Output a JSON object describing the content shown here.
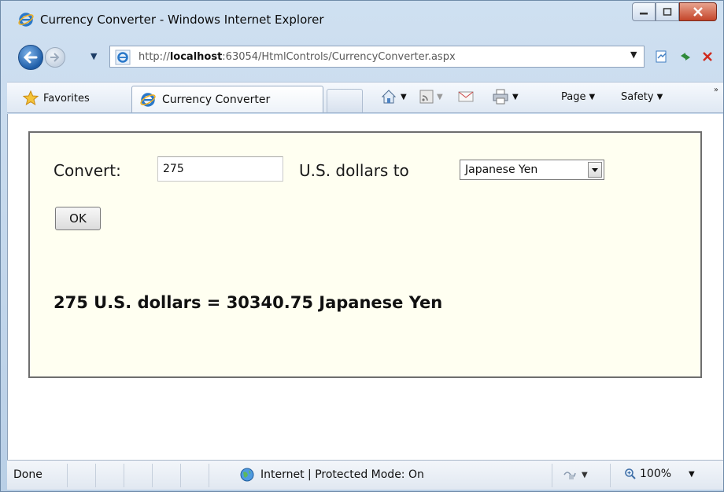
{
  "window": {
    "title": "Currency Converter - Windows Internet Explorer"
  },
  "address_bar": {
    "url_prefix": "http://",
    "url_host": "localhost",
    "url_rest": ":63054/HtmlControls/CurrencyConverter.aspx"
  },
  "command_bar": {
    "favorites_label": "Favorites",
    "tab_title": "Currency Converter",
    "page_label": "Page",
    "safety_label": "Safety"
  },
  "form": {
    "convert_label": "Convert:",
    "amount_value": "275",
    "usd_label": "U.S. dollars to",
    "currency_selected": "Japanese Yen",
    "ok_label": "OK",
    "result_text": "275 U.S. dollars = 30340.75 Japanese Yen"
  },
  "status_bar": {
    "status_text": "Done",
    "zone_text": "Internet | Protected Mode: On",
    "zoom_text": "100%"
  },
  "colors": {
    "panel_background": "#fffff1",
    "panel_border": "#6e6e6e",
    "close_button": "#c4452a"
  },
  "icons": {
    "title": "ie-logo-icon",
    "back": "back-arrow-icon",
    "forward": "forward-arrow-icon",
    "favorites": "star-icon",
    "home": "home-icon",
    "feeds": "rss-icon",
    "mail": "mail-icon",
    "print": "printer-icon",
    "zone": "globe-icon",
    "zoom": "magnifier-icon"
  }
}
